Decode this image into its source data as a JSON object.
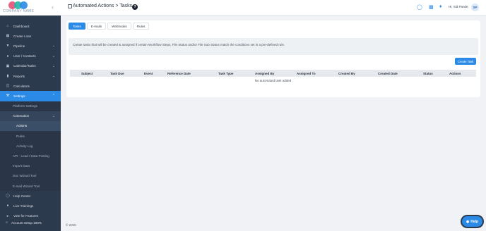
{
  "brand": {
    "logo_text": "COMPANY NAME",
    "colors": [
      "#e94e77",
      "#21b5a7",
      "#2b8ae6"
    ]
  },
  "sidebar": {
    "items": [
      {
        "label": "Dashboard",
        "icon": "home-icon"
      },
      {
        "label": "Create Loan",
        "icon": "folder-plus-icon"
      },
      {
        "label": "Pipeline",
        "icon": "filter-icon"
      },
      {
        "label": "User / Contacts",
        "icon": "user-icon"
      },
      {
        "label": "Calendar/Tasks",
        "icon": "calendar-icon"
      },
      {
        "label": "Reports",
        "icon": "chart-icon"
      },
      {
        "label": "Calculators",
        "icon": "calculator-icon"
      },
      {
        "label": "Settings",
        "icon": "wrench-icon"
      }
    ],
    "settings_sub": [
      {
        "label": "Platform Settings"
      },
      {
        "label": "Automation"
      }
    ],
    "automation_sub": [
      {
        "label": "Actions"
      },
      {
        "label": "Rules"
      },
      {
        "label": "Activity Log"
      }
    ],
    "settings_more": [
      {
        "label": "API - Lead / Data Posting"
      },
      {
        "label": "Import Data"
      },
      {
        "label": "Doc Wizard Tool"
      },
      {
        "label": "E-mail Wizard Tool"
      }
    ],
    "bottom_items": [
      {
        "label": "Help Center",
        "icon": "help-circle-icon"
      },
      {
        "label": "Live Trainings",
        "icon": "person-icon"
      },
      {
        "label": "Vote for Features",
        "icon": "megaphone-icon"
      }
    ],
    "account": {
      "label": "Account Setup 100%"
    }
  },
  "header": {
    "title": "Automated Actions > Tasks",
    "help_glyph": "?",
    "greeting": "Hi, Sid Pande",
    "avatar_initials": "SP"
  },
  "tabs": [
    {
      "label": "Tasks"
    },
    {
      "label": "E-mails"
    },
    {
      "label": "Webhooks"
    },
    {
      "label": "Rules"
    }
  ],
  "info_text": "Create tasks that will be created & assigned if certain Workflow Steps, File Status and/or File Sub Status match the conditions set in a pre-defined rule.",
  "create_button": "Create Task",
  "table": {
    "columns": [
      "Subject",
      "Task Due",
      "Event",
      "Reference Date",
      "Task Type",
      "Assigned By",
      "Assigned To",
      "Created By",
      "Created Date",
      "Status",
      "Actions"
    ],
    "empty_message": "No automated task added"
  },
  "footer": {
    "copyright": "© 2025"
  },
  "help_button": "Help"
}
